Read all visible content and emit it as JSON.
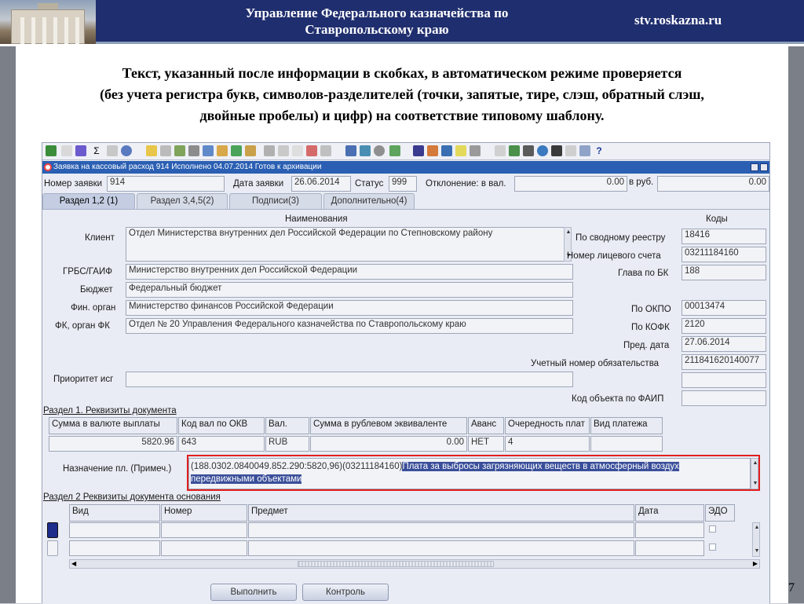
{
  "header": {
    "title_line1": "Управление Федерального казначейства по",
    "title_line2": "Ставропольскому краю",
    "site": "stv.roskazna.ru"
  },
  "caption": {
    "line1": "Текст, указанный после информации в скобках, в автоматическом режиме проверяется",
    "line2": "(без учета регистра букв, символов-разделителей (точки, запятые, тире, слэш, обратный слэш,",
    "line3": "двойные пробелы) и цифр) на соответствие типовому шаблону."
  },
  "page_number": "7",
  "window": {
    "title": "Заявка на кассовый расход 914 Исполнено 04.07.2014 Готов к архивации"
  },
  "top_fields": {
    "request_no_label": "Номер заявки",
    "request_no": "914",
    "date_label": "Дата заявки",
    "date": "26.06.2014",
    "status_label": "Статус",
    "status": "999",
    "deviation_label": "Отклонение: в вал.",
    "deviation_val": "0.00",
    "rub_label": "в руб.",
    "deviation_rub": "0.00"
  },
  "tabs": [
    {
      "label": "Раздел 1,2 (1)"
    },
    {
      "label": "Раздел 3,4,5(2)"
    },
    {
      "label": "Подписи(3)"
    },
    {
      "label": "Дополнительно(4)"
    }
  ],
  "form": {
    "names_header": "Наименования",
    "codes_header": "Коды",
    "client_label": "Клиент",
    "client": "Отдел Министерства внутренних дел Российской Федерации по Степновскому району",
    "grbs_label": "ГРБС/ГАИФ",
    "grbs": "Министерство внутренних дел Российской Федерации",
    "budget_label": "Бюджет",
    "budget": "Федеральный бюджет",
    "fin_label": "Фин. орган",
    "fin": "Министерство финансов Российской Федерации",
    "fk_label": "ФК, орган ФК",
    "fk": "Отдел № 20 Управления Федерального казначейства по Ставропольскому краю",
    "priority_label": "Приоритет исг",
    "codes": [
      {
        "label": "По сводному реестру",
        "value": "18416"
      },
      {
        "label": "Номер лицевого счета",
        "value": "03211184160"
      },
      {
        "label": "Глава по БК",
        "value": "188"
      },
      {
        "label": "По ОКПО",
        "value": "00013474"
      },
      {
        "label": "По КОФК",
        "value": "2120"
      },
      {
        "label": "Пред. дата",
        "value": "27.06.2014"
      },
      {
        "label": "Учетный номер обязательства",
        "value": "211841620140077"
      },
      {
        "label": "",
        "value": ""
      },
      {
        "label": "Код объекта по ФАИП",
        "value": ""
      }
    ]
  },
  "section1": {
    "title": "Раздел 1. Реквизиты документа",
    "headers": [
      "Сумма в валюте выплаты",
      "Код вал по ОКВ",
      "Вал.",
      "Сумма в рублевом эквиваленте",
      "Аванс",
      "Очередность плат",
      "Вид платежа"
    ],
    "values": [
      "5820.96",
      "643",
      "RUB",
      "0.00",
      "НЕТ",
      "4",
      ""
    ],
    "purpose_label": "Назначение пл. (Примеч.)",
    "purpose_prefix": "(188.0302.0840049.852.290:5820,96)(03211184160)",
    "purpose_highlight1": "Плата за выбросы загрязняющих веществ в атмосферный воздух",
    "purpose_highlight2": "передвижными объектами"
  },
  "section2": {
    "title": "Раздел 2 Реквизиты документа основания",
    "headers": [
      "Вид",
      "Номер",
      "Предмет",
      "Дата",
      "ЭДО"
    ]
  },
  "buttons": {
    "execute": "Выполнить",
    "control": "Контроль"
  }
}
